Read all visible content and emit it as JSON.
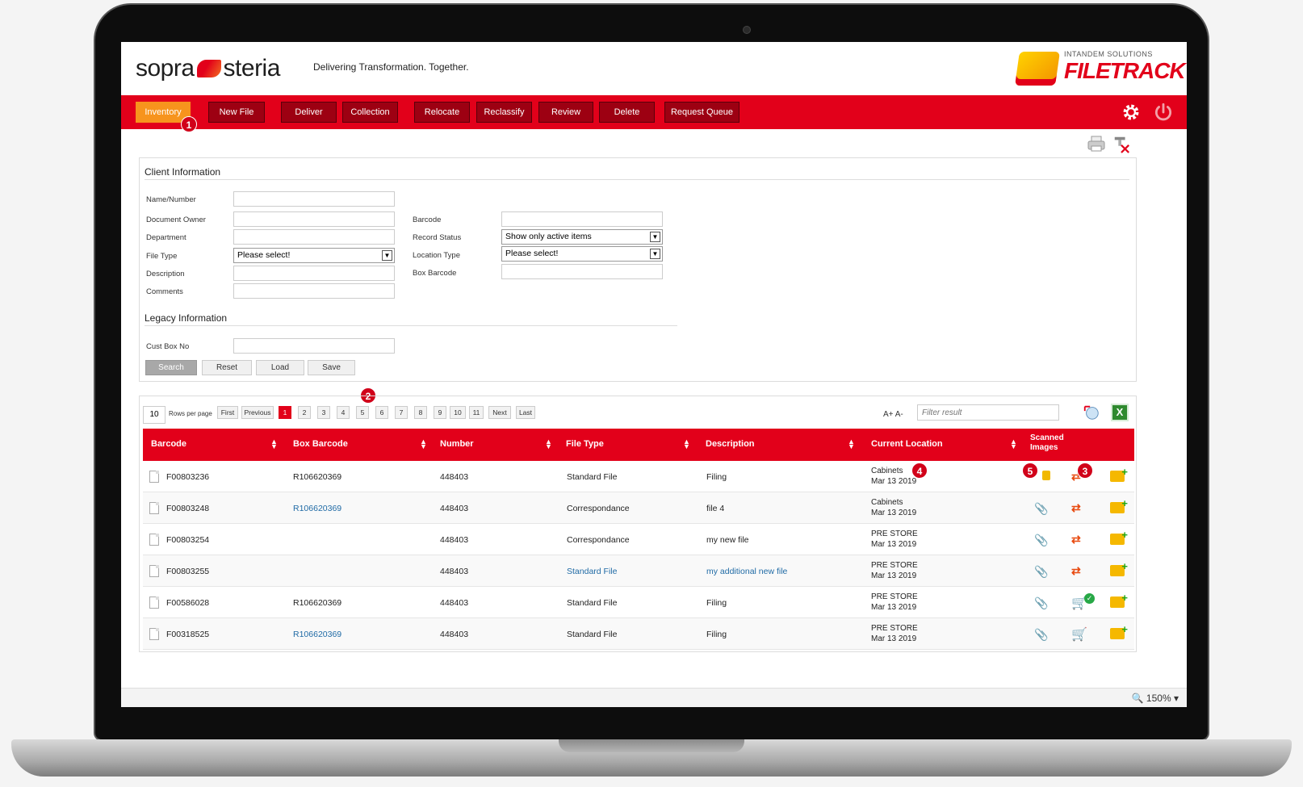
{
  "brand": {
    "logo": "sopra steria",
    "tagline": "Delivering Transformation. Together.",
    "product_small": "INTANDEM SOLUTIONS",
    "product": "FILETRACK"
  },
  "nav": {
    "items": [
      "Inventory",
      "New File",
      "Deliver",
      "Collection",
      "Relocate",
      "Reclassify",
      "Review",
      "Delete",
      "Request Queue"
    ],
    "active": "Inventory",
    "accent": "#e2001a",
    "active_color": "#f7941d"
  },
  "badges": [
    "1",
    "2",
    "3",
    "4",
    "5"
  ],
  "client": {
    "title": "Client Information",
    "labels": {
      "name_number": "Name/Number",
      "document_owner": "Document Owner",
      "department": "Department",
      "file_type": "File Type",
      "description": "Description",
      "comments": "Comments",
      "barcode": "Barcode",
      "record_status": "Record Status",
      "location_type": "Location Type",
      "box_barcode": "Box Barcode"
    },
    "values": {
      "file_type": "Please select!",
      "record_status": "Show only active items",
      "location_type": "Please select!"
    },
    "legacy_title": "Legacy Information",
    "cust_box_label": "Cust Box No",
    "buttons": [
      "Search",
      "Reset",
      "Load",
      "Save"
    ]
  },
  "results": {
    "rows_per_page": "10",
    "rows_label": "Rows per page",
    "pager": [
      "First",
      "Previous",
      "1",
      "2",
      "3",
      "4",
      "5",
      "6",
      "7",
      "8",
      "9",
      "10",
      "11",
      "Next",
      "Last"
    ],
    "current_page": "1",
    "font_ctl": "A+  A-",
    "filter_placeholder": "Filter result",
    "excel_label": "X",
    "columns": [
      "Barcode",
      "Box Barcode",
      "Number",
      "File Type",
      "Description",
      "Current Location"
    ],
    "scanned_col": [
      "Scanned",
      "Images"
    ],
    "rows": [
      {
        "barcode": "F00803236",
        "box": "R106620369",
        "number": "448403",
        "type": "Standard File",
        "desc": "Filing",
        "loc": "Cabinets",
        "date": "Mar 13 2019"
      },
      {
        "barcode": "F00803248",
        "box": "R106620369",
        "number": "448403",
        "type": "Correspondance",
        "desc": "file 4",
        "loc": "Cabinets",
        "date": "Mar 13 2019"
      },
      {
        "barcode": "F00803254",
        "box": "",
        "number": "448403",
        "type": "Correspondance",
        "desc": "my new file",
        "loc": "PRE STORE",
        "date": "Mar 13 2019"
      },
      {
        "barcode": "F00803255",
        "box": "",
        "number": "448403",
        "type": "Standard File",
        "desc": "my additional new file",
        "loc": "PRE STORE",
        "date": "Mar 13 2019"
      },
      {
        "barcode": "F00586028",
        "box": "R106620369",
        "number": "448403",
        "type": "Standard File",
        "desc": "Filing",
        "loc": "PRE STORE",
        "date": "Mar 13 2019"
      },
      {
        "barcode": "F00318525",
        "box": "R106620369",
        "number": "448403",
        "type": "Standard File",
        "desc": "Filing",
        "loc": "PRE STORE",
        "date": "Mar 13 2019"
      }
    ]
  },
  "status": {
    "zoom": "150%"
  }
}
